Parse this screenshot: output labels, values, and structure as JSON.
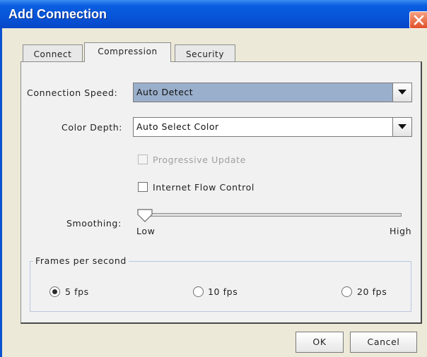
{
  "window": {
    "title": "Add Connection"
  },
  "tabs": [
    "Connect",
    "Compression",
    "Security"
  ],
  "active_tab": "Compression",
  "connection_speed": {
    "label": "Connection Speed:",
    "value": "Auto Detect"
  },
  "color_depth": {
    "label": "Color Depth:",
    "value": "Auto Select Color"
  },
  "progressive_update": {
    "label": "Progressive Update",
    "checked": false,
    "enabled": false
  },
  "internet_flow_control": {
    "label": "Internet Flow Control",
    "checked": false
  },
  "smoothing": {
    "label": "Smoothing:",
    "low": "Low",
    "high": "High",
    "level": 0
  },
  "fps": {
    "legend": "Frames per second",
    "options": [
      "5 fps",
      "10 fps",
      "20 fps"
    ],
    "selected": "5 fps"
  },
  "buttons": {
    "ok": "OK",
    "cancel": "Cancel"
  },
  "colors": {
    "titlebar": "#0754d8",
    "close": "#e05028",
    "selection": "#9aafcb"
  }
}
